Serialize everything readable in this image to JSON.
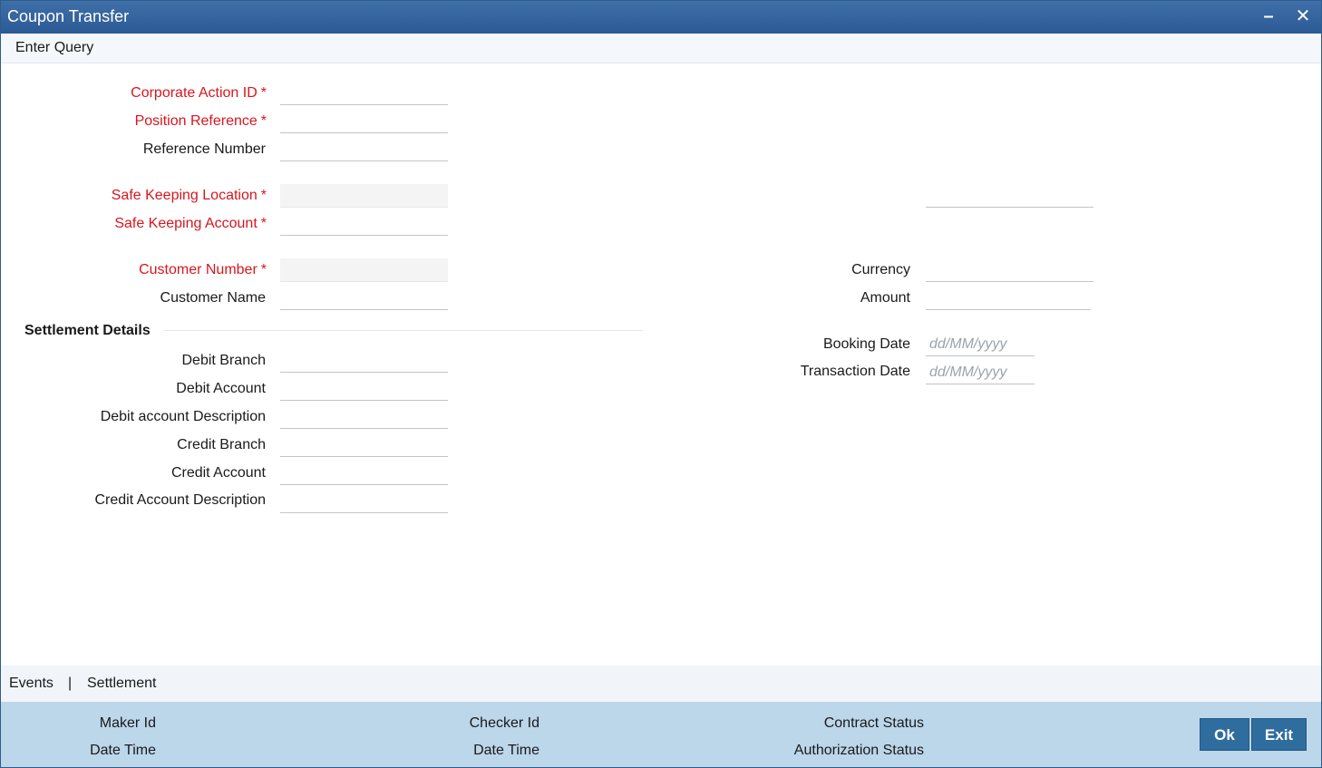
{
  "window": {
    "title": "Coupon Transfer"
  },
  "menu": {
    "enter_query": "Enter Query"
  },
  "fields": {
    "corporate_action_id": {
      "label": "Corporate Action ID",
      "value": ""
    },
    "position_reference": {
      "label": "Position Reference",
      "value": ""
    },
    "reference_number": {
      "label": "Reference Number",
      "value": ""
    },
    "safe_keeping_location": {
      "label": "Safe Keeping Location",
      "value": ""
    },
    "safe_keeping_account": {
      "label": "Safe Keeping Account",
      "value": ""
    },
    "customer_number": {
      "label": "Customer Number",
      "value": ""
    },
    "customer_name": {
      "label": "Customer Name",
      "value": ""
    },
    "currency": {
      "label": "Currency",
      "value": ""
    },
    "amount": {
      "label": "Amount",
      "value": ""
    },
    "booking_date": {
      "label": "Booking Date",
      "placeholder": "dd/MM/yyyy"
    },
    "transaction_date": {
      "label": "Transaction Date",
      "placeholder": "dd/MM/yyyy"
    }
  },
  "required_marker": "*",
  "settlement": {
    "title": "Settlement Details",
    "debit_branch": "Debit Branch",
    "debit_account": "Debit Account",
    "debit_account_description": "Debit account Description",
    "credit_branch": "Credit Branch",
    "credit_account": "Credit Account",
    "credit_account_description": "Credit Account Description"
  },
  "subtabs": {
    "events": "Events",
    "separator": "|",
    "settlement": "Settlement"
  },
  "footer": {
    "maker_id": "Maker Id",
    "maker_date_time": "Date Time",
    "checker_id": "Checker Id",
    "checker_date_time": "Date Time",
    "contract_status": "Contract Status",
    "authorization_status": "Authorization Status",
    "ok": "Ok",
    "exit": "Exit"
  }
}
